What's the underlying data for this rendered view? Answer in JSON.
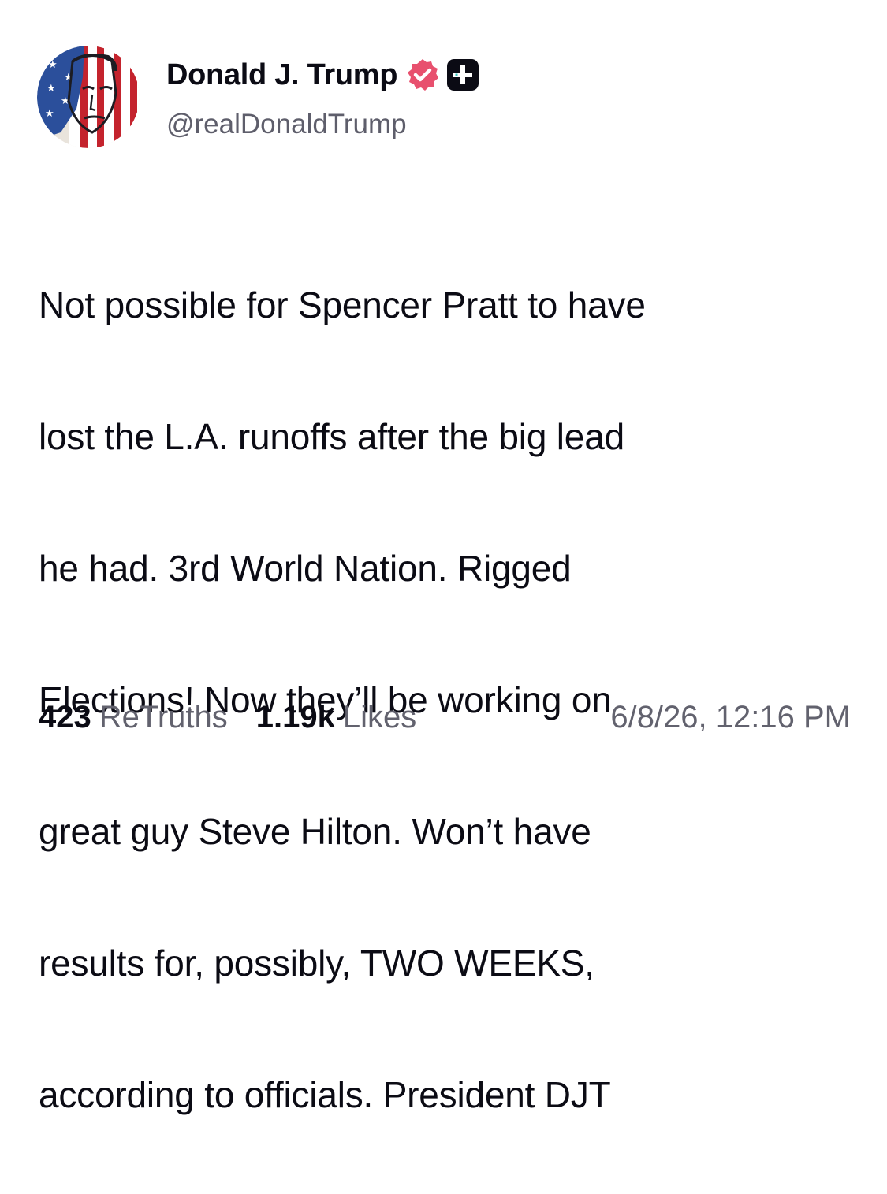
{
  "author": {
    "display_name": "Donald J. Trump",
    "handle": "@realDonaldTrump",
    "avatar_icon": "avatar-image",
    "verified_icon": "verified-badge-icon",
    "verified_color": "#e8506e",
    "plus_icon": "plus-badge-icon"
  },
  "post": {
    "lines": [
      "Not possible for Spencer Pratt to have",
      "lost the L.A. runoffs after the big lead",
      "he had. 3rd World Nation. Rigged",
      "Elections! Now they’ll be working on",
      "great guy Steve Hilton. Won’t have",
      "results for, possibly, TWO WEEKS,",
      "according to officials. President DJT"
    ]
  },
  "stats": {
    "retruths_count": "423",
    "retruths_label": "ReTruths",
    "likes_count": "1.19k",
    "likes_label": "Likes",
    "timestamp": "6/8/26, 12:16 PM"
  }
}
